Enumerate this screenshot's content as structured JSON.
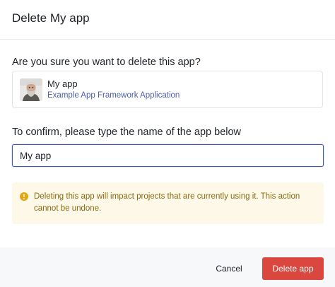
{
  "dialog": {
    "title": "Delete My app",
    "question": "Are you sure you want to delete this app?",
    "app": {
      "name": "My app",
      "description": "Example App Framework Application"
    },
    "confirm_label": "To confirm, please type the name of the app below",
    "input_value": "My app",
    "warning": {
      "icon": "warning-circle-icon",
      "text": "Deleting this app will impact projects that are currently using it. This action cannot be undone."
    },
    "buttons": {
      "cancel": "Cancel",
      "delete": "Delete app"
    }
  },
  "colors": {
    "danger": "#d9473f",
    "input_focus_border": "#3d55c5",
    "link_blue": "#4e5fa3",
    "warning_bg": "#fdf8e8",
    "warning_text": "#8a6a12",
    "warning_icon": "#e2a812",
    "footer_bg": "#f7f8fa"
  }
}
